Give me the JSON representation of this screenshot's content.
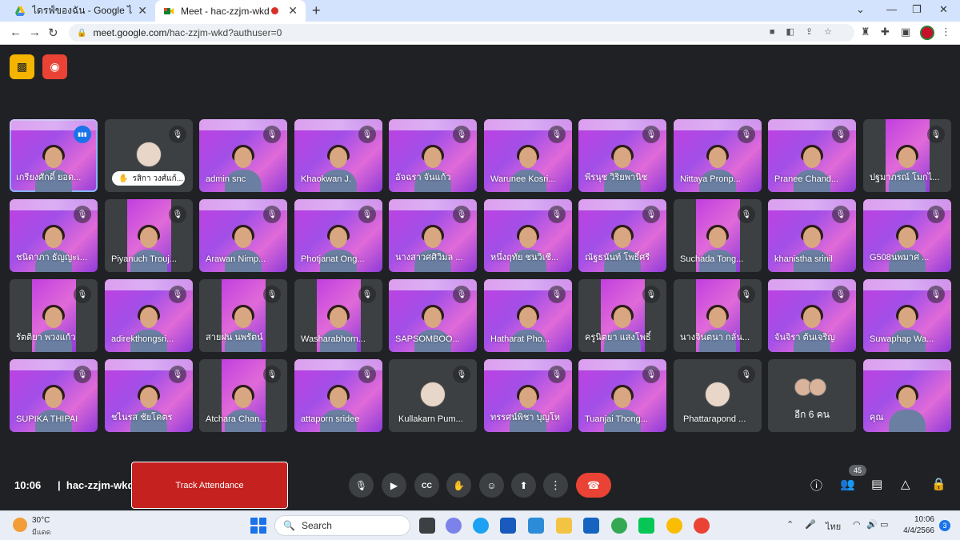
{
  "browser": {
    "tabs": [
      {
        "title": "ไดรฟ์ของฉัน - Google ไดรฟ์",
        "active": false
      },
      {
        "title": "Meet - hac-zzjm-wkd",
        "active": true
      }
    ],
    "url_host": "meet.google.com",
    "url_path": "/hac-zzjm-wkd?authuser=0"
  },
  "meet": {
    "time": "10:06",
    "separator": "|",
    "meeting_code": "hac-zzjm-wkd",
    "track_attendance_label": "Track Attendance",
    "people_count": "45",
    "more_tile_label": "อีก 6 คน",
    "participants": [
      {
        "name": "เกรียงศักดิ์ ยอด...",
        "type": "purple",
        "speaking": true
      },
      {
        "name": "รสิกา วงศ์แก้...",
        "type": "hand"
      },
      {
        "name": "admin snc",
        "type": "purple"
      },
      {
        "name": "Khaokwan J.",
        "type": "purple"
      },
      {
        "name": "อัจฉรา จันแก้ว",
        "type": "purple"
      },
      {
        "name": "Warunee Kosri...",
        "type": "purple"
      },
      {
        "name": "พีรนุช วิริยพานิช",
        "type": "purple"
      },
      {
        "name": "Nittaya Pronp...",
        "type": "purple"
      },
      {
        "name": "Pranee Chand...",
        "type": "purple"
      },
      {
        "name": "ปฐมาภรณ์ โมกไ...",
        "type": "dark-video"
      },
      {
        "name": "ชนิดาภา ธัญญะเ...",
        "type": "purple"
      },
      {
        "name": "Piyanuch Trouj...",
        "type": "dark-video"
      },
      {
        "name": "Arawan Nimp...",
        "type": "purple"
      },
      {
        "name": "Photjanat Ong...",
        "type": "purple"
      },
      {
        "name": "นางสาวศศิวิมล ...",
        "type": "purple"
      },
      {
        "name": "หนึ่งฤทัย ชนวิเชี...",
        "type": "purple"
      },
      {
        "name": "ณัฐธนันท์ โพธิ์ศรี",
        "type": "purple"
      },
      {
        "name": "Suchada Tong...",
        "type": "dark-video"
      },
      {
        "name": "khanistha srinil",
        "type": "purple"
      },
      {
        "name": "G508นพมาศ ...",
        "type": "purple"
      },
      {
        "name": "รัตติยา พวงแก้ว",
        "type": "dark-video"
      },
      {
        "name": "adirekthongsri...",
        "type": "purple"
      },
      {
        "name": "สายฝน นพรัตน์",
        "type": "dark-video"
      },
      {
        "name": "Washarabhorn...",
        "type": "dark-video"
      },
      {
        "name": "SAPSOMBOO...",
        "type": "purple"
      },
      {
        "name": "Hatharat Pho...",
        "type": "purple"
      },
      {
        "name": "ครูนิตยา แสงโพธิ์",
        "type": "dark-video"
      },
      {
        "name": "นางจินตนา กลั่น...",
        "type": "dark-video"
      },
      {
        "name": "จันจิรา ต้นเจริญ",
        "type": "purple"
      },
      {
        "name": "Suwaphap Wa...",
        "type": "purple"
      },
      {
        "name": "SUPIKA THIPAI",
        "type": "purple"
      },
      {
        "name": "ชไนรส ชัยโคตร",
        "type": "purple"
      },
      {
        "name": "Atchara Chan...",
        "type": "dark-video"
      },
      {
        "name": "attaporn sridee",
        "type": "purple"
      },
      {
        "name": "Kullakarn Pum...",
        "type": "avatar"
      },
      {
        "name": "ทรรศน์พิชา บุญโห",
        "type": "purple"
      },
      {
        "name": "Tuanjai Thong...",
        "type": "purple"
      },
      {
        "name": "Phattarapond ...",
        "type": "avatar"
      },
      {
        "name": "",
        "type": "more"
      },
      {
        "name": "คุณ",
        "type": "self"
      }
    ]
  },
  "taskbar": {
    "temperature": "30°C",
    "condition": "มีแดด",
    "search_label": "Search",
    "language": "ไทย",
    "time": "10:06",
    "date": "4/4/2566",
    "notifications": "3"
  },
  "colors": {
    "accent_red": "#c5221f",
    "hangup": "#ea4335",
    "tile_purple": "#c13fe0",
    "speaking_outline": "#8ab4f8"
  }
}
